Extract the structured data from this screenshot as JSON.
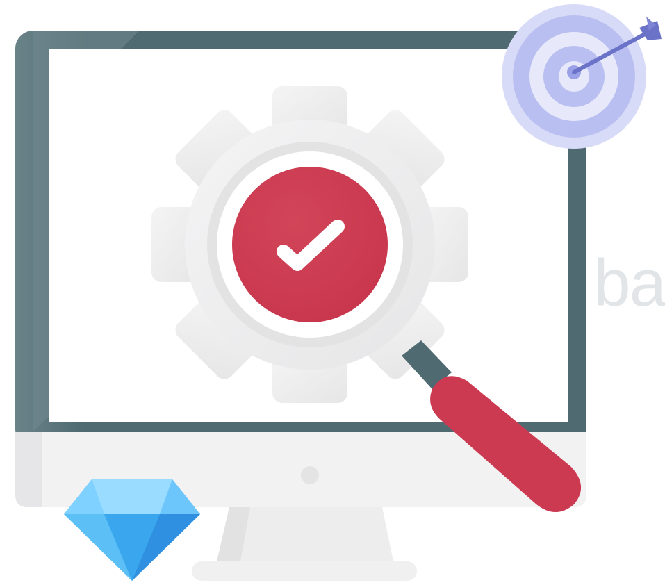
{
  "illustration": {
    "icons": {
      "monitor": "monitor-icon",
      "gear": "gear-icon",
      "check": "checkmark-icon",
      "magnifier": "magnifying-glass-icon",
      "target": "target-icon",
      "arrow": "arrow-icon",
      "diamond": "diamond-icon"
    },
    "colors": {
      "monitor_frame": "#4f6a71",
      "monitor_frame_light": "#6a8389",
      "screen": "#ffffff",
      "monitor_bottom": "#f2f2f3",
      "stand": "#ebebec",
      "gear": "#eeeeee",
      "gear_ring": "#e1e1e2",
      "check_circle": "#cc3a52",
      "magnifier_handle": "#cc3a52",
      "magnifier_neck": "#4f6a71",
      "target_outer": "#b9bff0",
      "target_ring": "#d8dbf7",
      "target_center": "#9aa1e6",
      "arrow": "#6b73c8",
      "diamond_light": "#7fd1ff",
      "diamond_mid": "#4bb4f5",
      "diamond_dark": "#2f8fe0"
    }
  },
  "background_text": {
    "partial_letters": "ba"
  }
}
